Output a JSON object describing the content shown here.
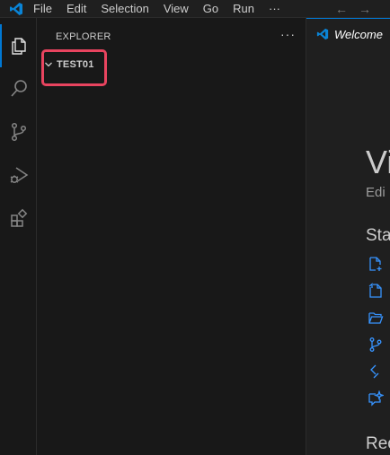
{
  "menu": {
    "items": [
      "File",
      "Edit",
      "Selection",
      "View",
      "Go",
      "Run"
    ],
    "more": "···"
  },
  "nav": {
    "back": "←",
    "forward": "→"
  },
  "activity_bar": {
    "icons": [
      "explorer-icon",
      "search-icon",
      "source-control-icon",
      "run-debug-icon",
      "extensions-icon"
    ],
    "active": "explorer-icon"
  },
  "sidebar": {
    "header": "EXPLORER",
    "more": "···",
    "folder": "TEST01"
  },
  "editor": {
    "tab_label": "Welcome",
    "title": "Vi",
    "subtitle": "Edi",
    "start_heading": "Sta",
    "start_icons": [
      "new-file-icon",
      "open-file-icon",
      "open-folder-icon",
      "clone-repo-icon",
      "remote-icon",
      "chat-icon"
    ],
    "recent_heading": "Rec"
  },
  "colors": {
    "accent": "#0078d4",
    "highlight": "#e8445f",
    "link": "#3794ff"
  }
}
